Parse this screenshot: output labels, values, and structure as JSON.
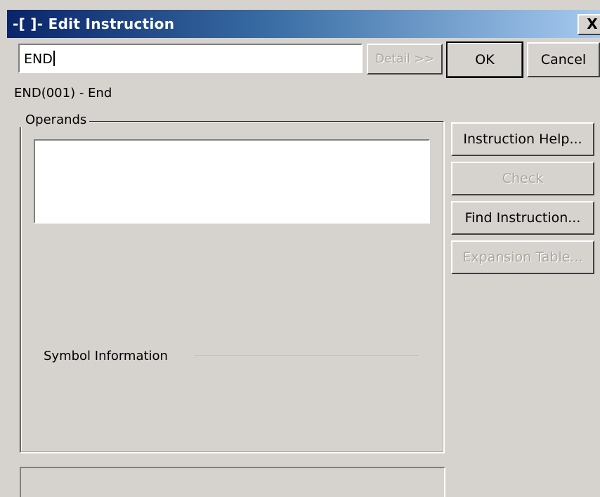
{
  "window": {
    "title": "-[ ]- Edit Instruction",
    "close_label": "X"
  },
  "instruction_input": {
    "value": "END"
  },
  "buttons": {
    "detail": "Detail >>",
    "ok": "OK",
    "cancel": "Cancel"
  },
  "description": "END(001) - End",
  "operands": {
    "legend": "Operands",
    "items": []
  },
  "symbol_information": {
    "label": "Symbol Information"
  },
  "side_buttons": {
    "instruction_help": "Instruction Help...",
    "check": "Check",
    "find_instruction": "Find Instruction...",
    "expansion_table": "Expansion Table..."
  },
  "colors": {
    "title_gradient_start": "#0a246a",
    "title_gradient_end": "#a6caf0",
    "dialog_face": "#d6d3ce"
  }
}
